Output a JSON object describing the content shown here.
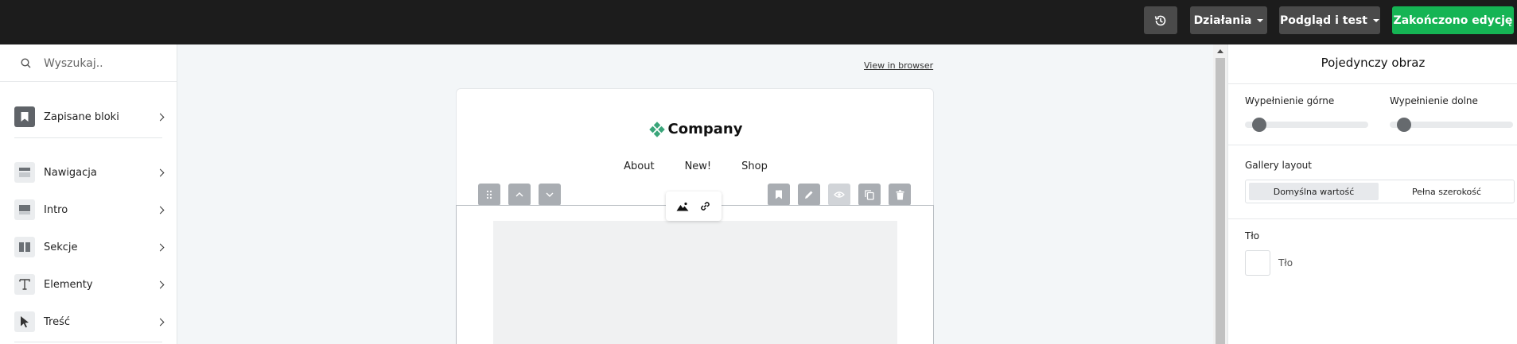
{
  "topbar": {
    "history_icon": "history-icon",
    "actions_label": "Działania",
    "preview_label": "Podgląd i test",
    "done_label": "Zakończono edycję",
    "done_color": "#15b454"
  },
  "sidebar": {
    "search": {
      "placeholder": "Wyszukaj.."
    },
    "saved_blocks": {
      "label": "Zapisane bloki",
      "icon": "bookmark-icon"
    },
    "items": [
      {
        "label": "Nawigacja",
        "icon": "navigation-layout-icon"
      },
      {
        "label": "Intro",
        "icon": "intro-layout-icon"
      },
      {
        "label": "Sekcje",
        "icon": "sections-layout-icon"
      },
      {
        "label": "Elementy",
        "icon": "text-t-icon"
      },
      {
        "label": "Treść",
        "icon": "cursor-pointer-icon"
      }
    ]
  },
  "canvas": {
    "view_in_browser": "View in browser",
    "logo_text": "Company",
    "logo_color": "#3aa57a",
    "nav": [
      "About",
      "New!",
      "Shop"
    ]
  },
  "right_panel": {
    "title": "Pojedynczy obraz",
    "padding_top_label": "Wypełnienie górne",
    "padding_bottom_label": "Wypełnienie dolne",
    "padding_top_value": 0.2,
    "padding_bottom_value": 0.2,
    "gallery_layout_label": "Gallery layout",
    "gallery_options": [
      "Domyślna wartość",
      "Pełna szerokość"
    ],
    "gallery_selected": "Domyślna wartość",
    "background_label": "Tło",
    "background_value": "Tło"
  }
}
